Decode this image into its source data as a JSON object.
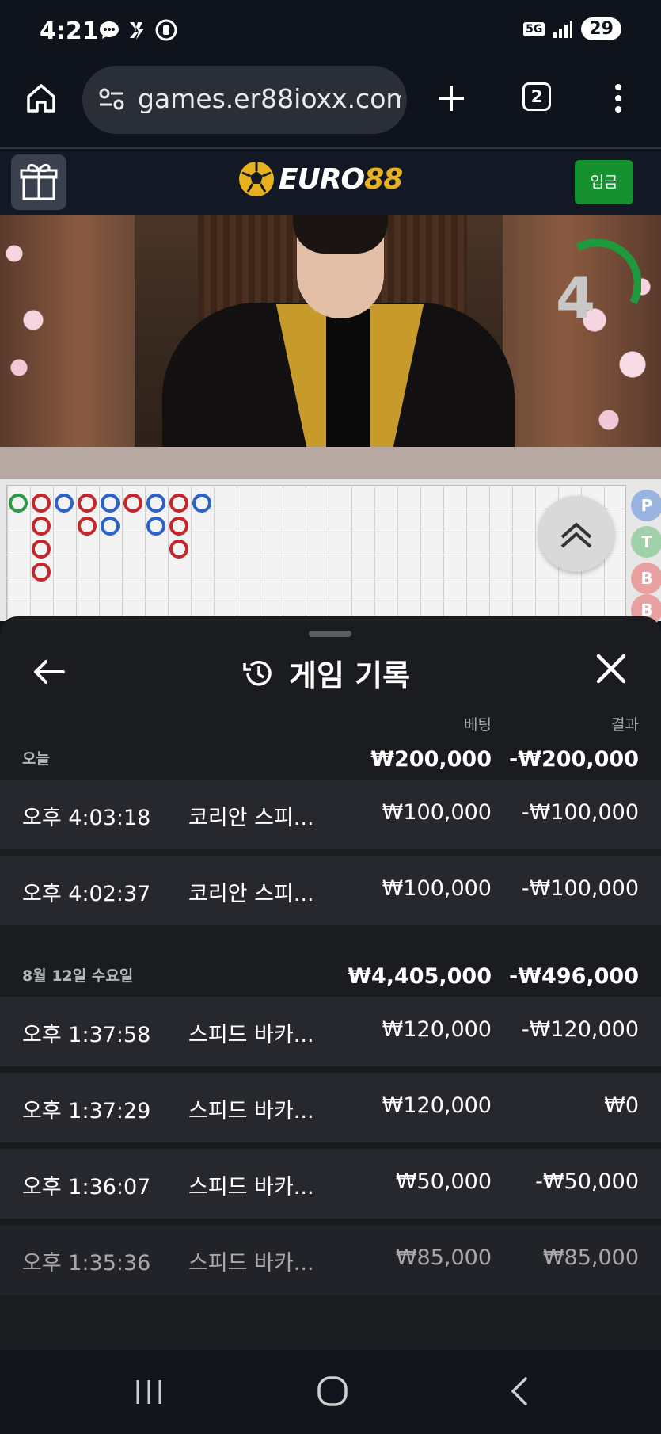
{
  "status_bar": {
    "time": "4:21",
    "network": "5G",
    "battery": "29"
  },
  "browser": {
    "url": "games.er88ioxx.com",
    "tab_count": "2"
  },
  "site_header": {
    "logo_text_part1": "EURO",
    "logo_text_part2": "88",
    "deposit_label": "입금",
    "brand_color": "#e6b01e",
    "deposit_color": "#16912f"
  },
  "video": {
    "countdown": "4"
  },
  "roadmap": {
    "side_labels": [
      "P",
      "T",
      "B",
      "B"
    ]
  },
  "sheet": {
    "title": "게임 기록",
    "col_bet": "베팅",
    "col_result": "결과",
    "groups": [
      {
        "date": "오늘",
        "bet_total": "₩200,000",
        "result_total": "-₩200,000",
        "rows": [
          {
            "time": "오후 4:03:18",
            "game": "코리안 스피...",
            "bet": "₩100,000",
            "result": "-₩100,000"
          },
          {
            "time": "오후 4:02:37",
            "game": "코리안 스피...",
            "bet": "₩100,000",
            "result": "-₩100,000"
          }
        ]
      },
      {
        "date": "8월 12일 수요일",
        "bet_total": "₩4,405,000",
        "result_total": "-₩496,000",
        "rows": [
          {
            "time": "오후 1:37:58",
            "game": "스피드 바카...",
            "bet": "₩120,000",
            "result": "-₩120,000"
          },
          {
            "time": "오후 1:37:29",
            "game": "스피드 바카...",
            "bet": "₩120,000",
            "result": "₩0"
          },
          {
            "time": "오후 1:36:07",
            "game": "스피드 바카...",
            "bet": "₩50,000",
            "result": "-₩50,000"
          },
          {
            "time": "오후 1:35:36",
            "game": "스피드 바카...",
            "bet": "₩85,000",
            "result": "₩85,000"
          }
        ]
      }
    ]
  }
}
